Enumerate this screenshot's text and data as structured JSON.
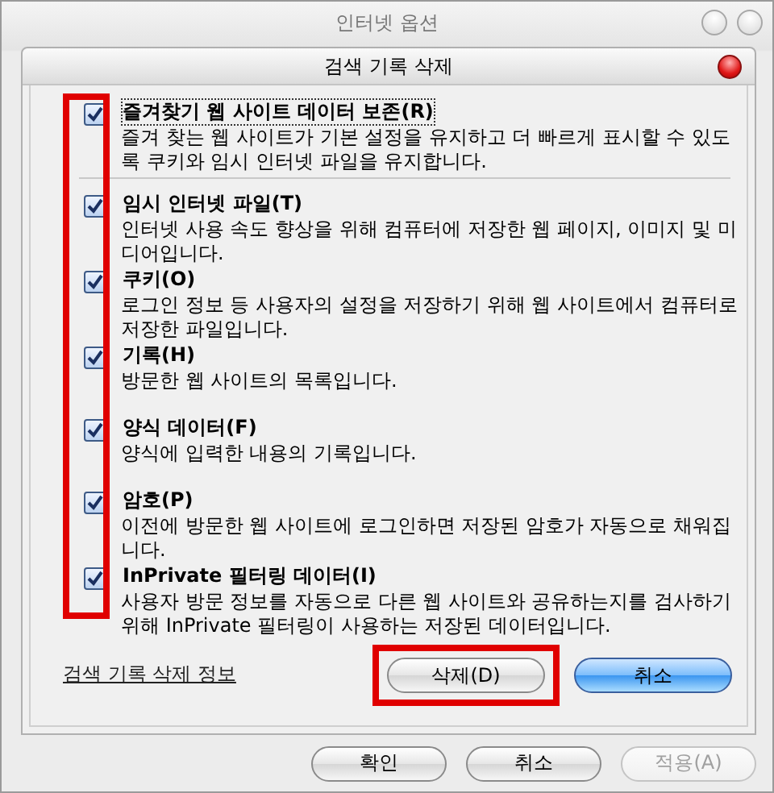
{
  "window": {
    "title": "인터넷 옵션"
  },
  "dialog": {
    "title": "검색 기록 삭제",
    "checkbox_column_highlighted": true,
    "options": [
      {
        "label": "즐겨찾기 웹 사이트 데이터 보존(R)",
        "description": "즐겨 찾는 웹 사이트가 기본 설정을 유지하고 더 빠르게 표시할 수 있도록 쿠키와 임시 인터넷 파일을 유지합니다.",
        "checked": true,
        "focused": true
      },
      {
        "label": "임시 인터넷 파일(T)",
        "description": "인터넷 사용 속도 향상을 위해 컴퓨터에 저장한 웹 페이지, 이미지 및 미디어입니다.",
        "checked": true,
        "focused": false
      },
      {
        "label": "쿠키(O)",
        "description": "로그인 정보 등 사용자의 설정을 저장하기 위해 웹 사이트에서 컴퓨터로 저장한 파일입니다.",
        "checked": true,
        "focused": false
      },
      {
        "label": "기록(H)",
        "description": "방문한 웹 사이트의 목록입니다.",
        "checked": true,
        "focused": false
      },
      {
        "label": "양식 데이터(F)",
        "description": "양식에 입력한 내용의 기록입니다.",
        "checked": true,
        "focused": false
      },
      {
        "label": "암호(P)",
        "description": "이전에 방문한 웹 사이트에 로그인하면 저장된 암호가 자동으로 채워집니다.",
        "checked": true,
        "focused": false
      },
      {
        "label": "InPrivate 필터링 데이터(I)",
        "description": "사용자 방문 정보를 자동으로 다른 웹 사이트와 공유하는지를 검사하기 위해 InPrivate 필터링이 사용하는 저장된 데이터입니다.",
        "checked": true,
        "focused": false
      }
    ],
    "link": "검색 기록 삭제 정보",
    "buttons": [
      {
        "label": "삭제(D)",
        "default": false,
        "highlighted": true
      },
      {
        "label": "취소",
        "default": true,
        "highlighted": false
      }
    ]
  },
  "buttons": [
    {
      "label": "확인",
      "disabled": false
    },
    {
      "label": "취소",
      "disabled": false
    },
    {
      "label": "적용(A)",
      "disabled": true
    }
  ]
}
